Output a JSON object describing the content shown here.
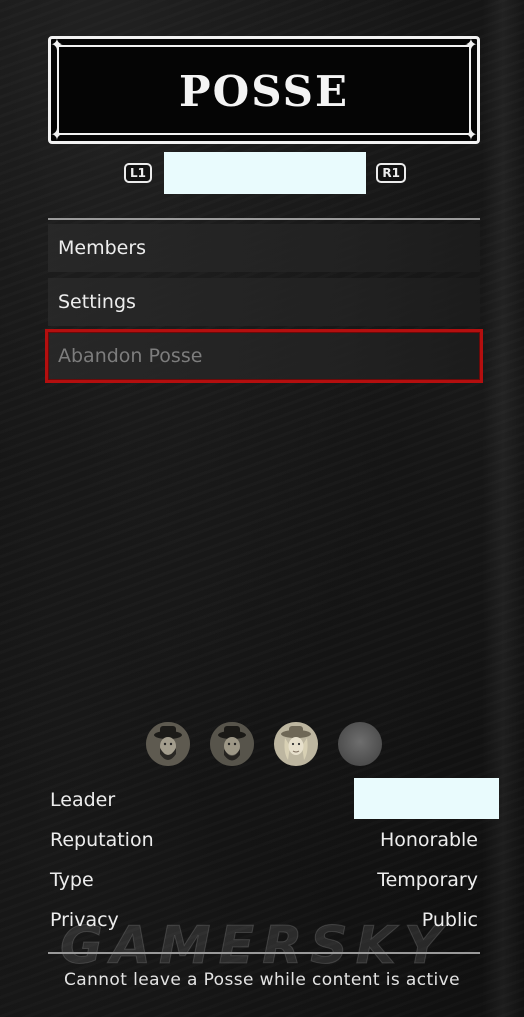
{
  "title": "POSSE",
  "tabs": {
    "left_bumper": "L1",
    "right_bumper": "R1"
  },
  "menu": {
    "items": [
      {
        "label": "Members",
        "state": "enabled"
      },
      {
        "label": "Settings",
        "state": "enabled"
      },
      {
        "label": "Abandon Posse",
        "state": "disabled-selected"
      }
    ]
  },
  "members": {
    "avatars": [
      "avatar-bearded-man-hat",
      "avatar-bearded-man-hat",
      "avatar-woman-hat",
      "avatar-empty-slot"
    ]
  },
  "info": {
    "leader_label": "Leader",
    "reputation_label": "Reputation",
    "reputation_value": "Honorable",
    "type_label": "Type",
    "type_value": "Temporary",
    "privacy_label": "Privacy",
    "privacy_value": "Public"
  },
  "footer_note": "Cannot leave a Posse while content is active",
  "watermark": "GAMERSKY",
  "colors": {
    "selection_outline": "#b40f0f",
    "redaction": "#e9fbfd",
    "disabled_text": "#7d7d7d"
  }
}
